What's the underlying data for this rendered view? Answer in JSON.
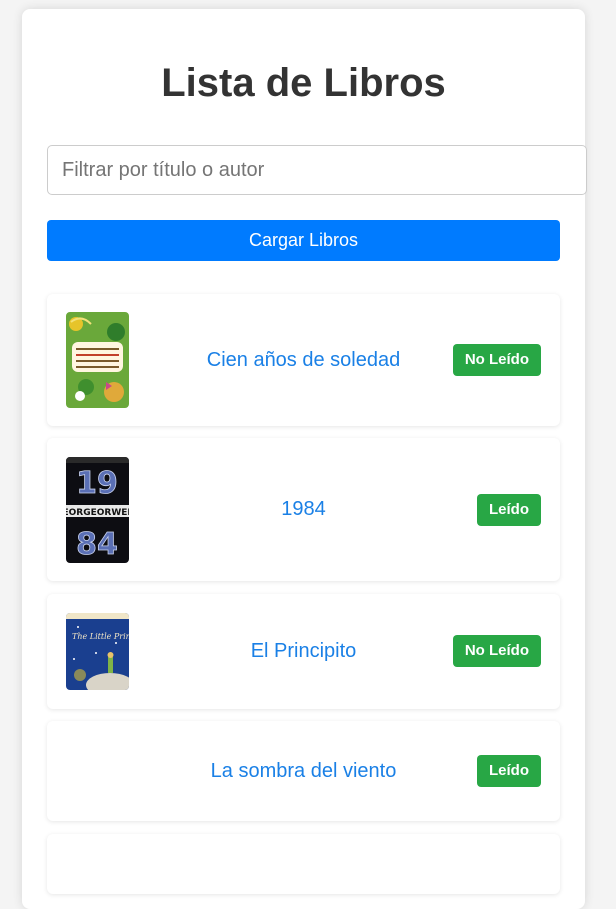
{
  "page": {
    "title": "Lista de Libros"
  },
  "filter": {
    "placeholder": "Filtrar por título o autor",
    "value": ""
  },
  "load_button": {
    "label": "Cargar Libros"
  },
  "books": [
    {
      "title": "Cien años de soledad",
      "status": "No Leído",
      "cover": "cien-anos-cover"
    },
    {
      "title": "1984",
      "status": "Leído",
      "cover": "1984-cover"
    },
    {
      "title": "El Principito",
      "status": "No Leído",
      "cover": "principito-cover"
    },
    {
      "title": "La sombra del viento",
      "status": "Leído",
      "cover": null
    }
  ],
  "colors": {
    "accent": "#007bff",
    "status": "#28a745",
    "link": "#1a80e6",
    "title": "#333333"
  }
}
